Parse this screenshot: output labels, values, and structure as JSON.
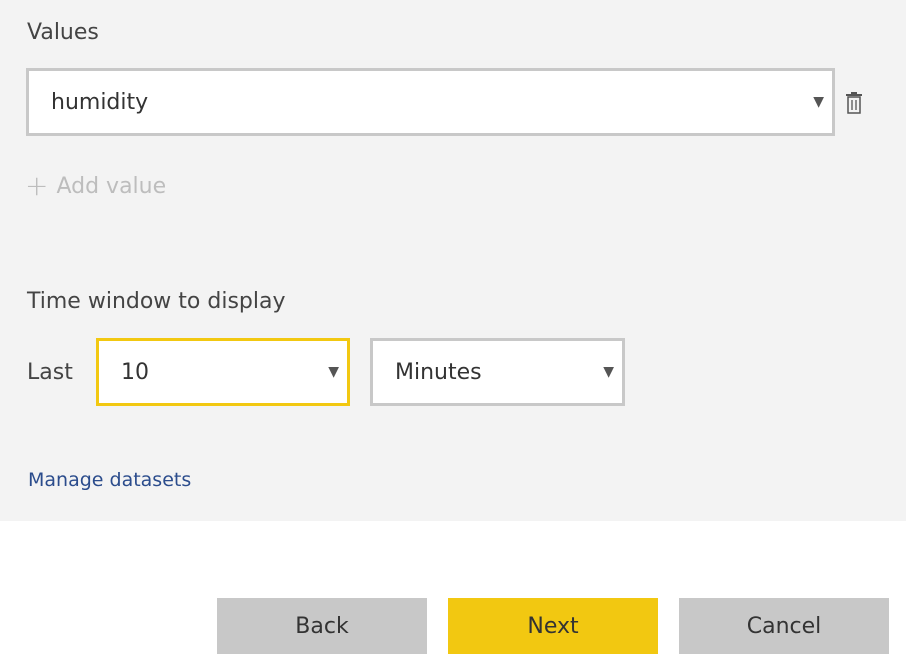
{
  "values_section": {
    "label": "Values",
    "selected_value": "humidity",
    "add_value_label": "Add value"
  },
  "time_window": {
    "label": "Time window to display",
    "last_label": "Last",
    "amount": "10",
    "unit": "Minutes"
  },
  "manage_link": "Manage datasets",
  "buttons": {
    "back": "Back",
    "next": "Next",
    "cancel": "Cancel"
  },
  "icons": {
    "dropdown": "caret-down-icon",
    "delete": "trash-icon",
    "add": "plus-icon"
  },
  "colors": {
    "accent": "#f2c811",
    "panel_bg": "#f3f3f3",
    "button_grey": "#c8c8c8",
    "link": "#2b4c8c"
  }
}
